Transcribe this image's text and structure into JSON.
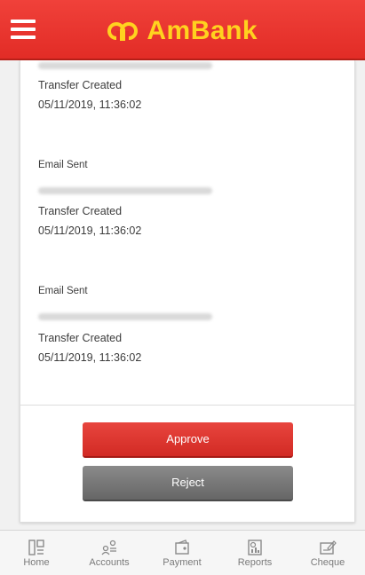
{
  "header": {
    "brand": "AmBank",
    "menu_icon": "hamburger-menu-icon",
    "logo_icon": "ambank-logo-icon",
    "brand_color": "#e8342e",
    "brand_text_color": "#ffd21f"
  },
  "activity_log": [
    {
      "event": "",
      "email_masked": true,
      "status": "Transfer Created",
      "timestamp": "05/11/2019, 11:36:02"
    },
    {
      "event": "Email Sent",
      "email_masked": true,
      "status": "Transfer Created",
      "timestamp": "05/11/2019, 11:36:02"
    },
    {
      "event": "Email Sent",
      "email_masked": true,
      "status": "Transfer Created",
      "timestamp": "05/11/2019, 11:36:02"
    }
  ],
  "actions": {
    "approve_label": "Approve",
    "reject_label": "Reject",
    "approve_color": "#dc3a34",
    "reject_color": "#777777"
  },
  "bottom_nav": [
    {
      "label": "Home",
      "icon": "home-icon"
    },
    {
      "label": "Accounts",
      "icon": "accounts-icon"
    },
    {
      "label": "Payment",
      "icon": "payment-icon"
    },
    {
      "label": "Reports",
      "icon": "reports-icon"
    },
    {
      "label": "Cheque",
      "icon": "cheque-icon"
    }
  ]
}
